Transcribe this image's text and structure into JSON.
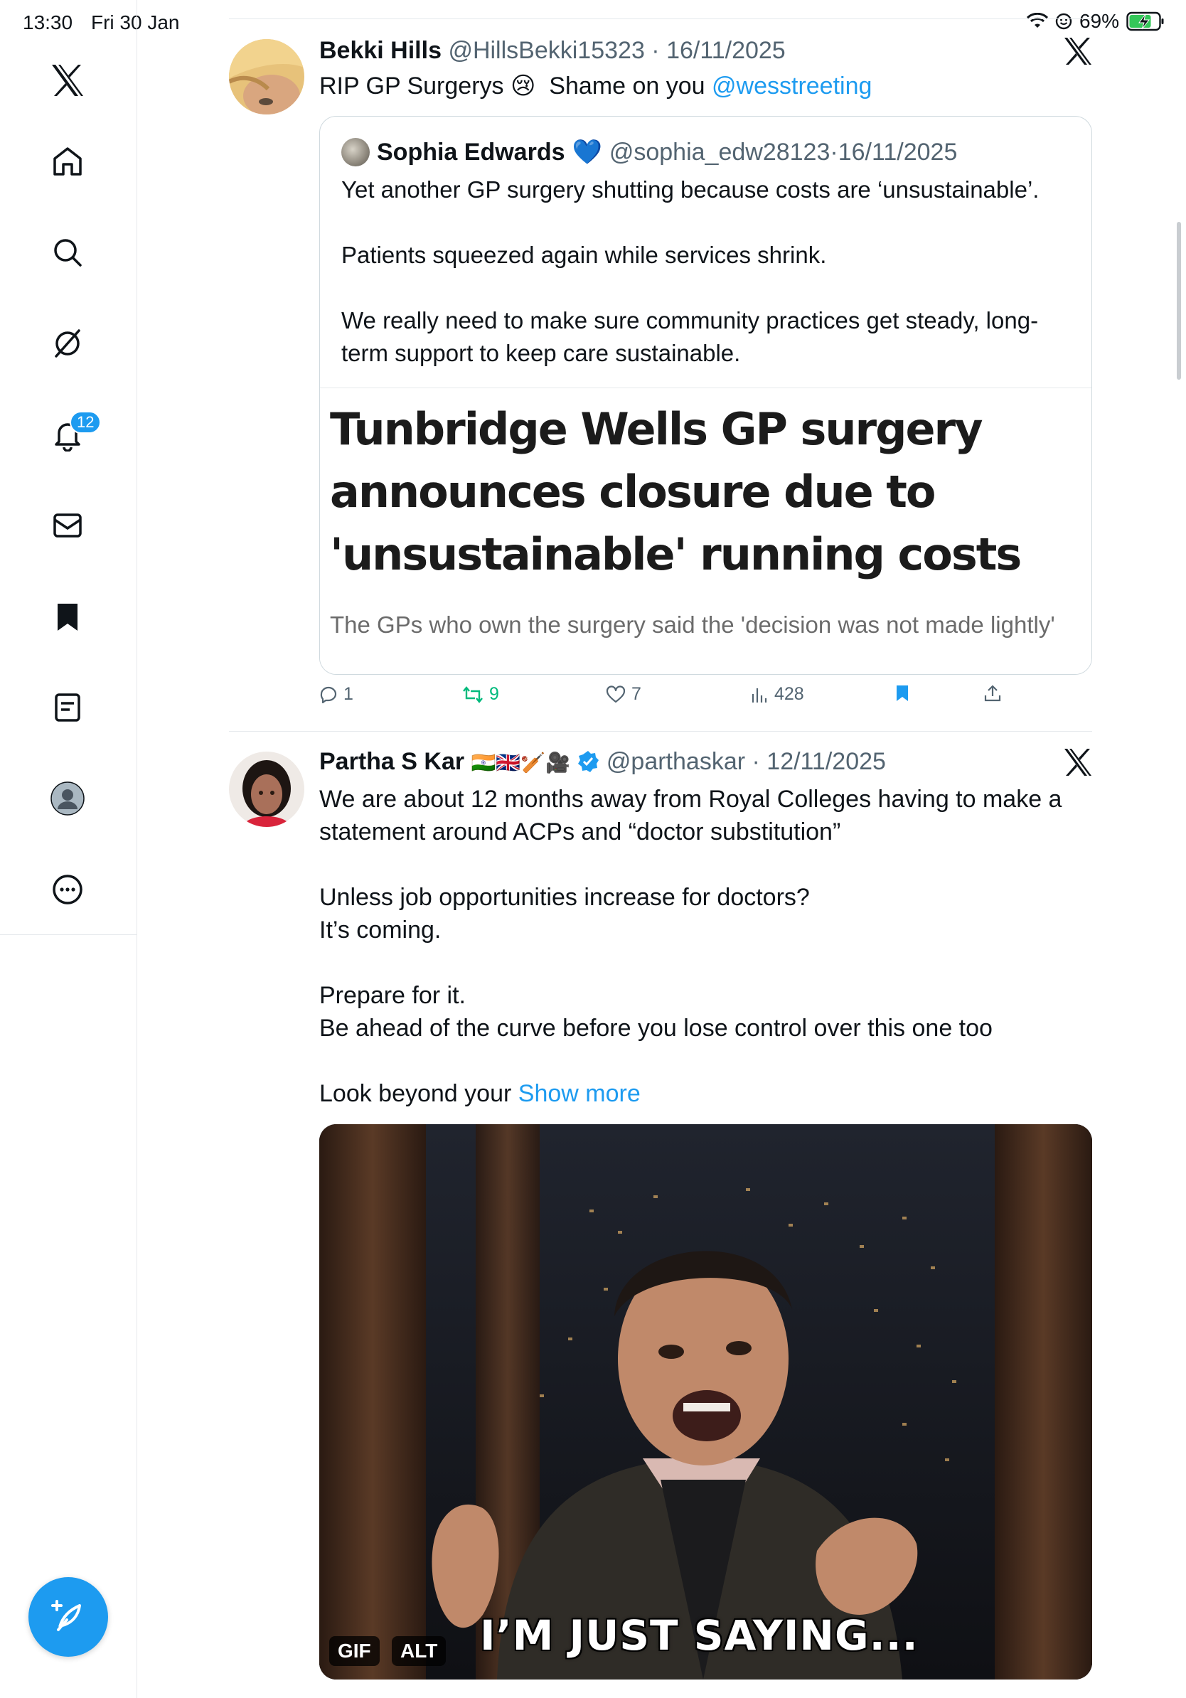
{
  "status_bar": {
    "time": "13:30",
    "date": "Fri 30 Jan",
    "battery": "69%"
  },
  "sidebar": {
    "notification_badge": "12",
    "items": [
      "x-logo",
      "home",
      "search",
      "grok",
      "notifications",
      "messages",
      "bookmarks",
      "lists",
      "profile",
      "more"
    ]
  },
  "tweets": [
    {
      "name": "Bekki Hills",
      "handle": "@HillsBekki15323",
      "date": "16/11/2025",
      "text_before": "RIP GP Surgerys 😢  Shame on you ",
      "mention": "@wesstreeting",
      "quote": {
        "name": "Sophia Edwards",
        "emoji": "💙",
        "handle": "@sophia_edw28123",
        "date": "16/11/2025",
        "text": "Yet another GP surgery shutting because costs are ‘unsustainable’.\n\nPatients squeezed again while services shrink.\n\nWe really need to make sure community practices get steady, long-term support to keep care sustainable.",
        "headline": "Tunbridge Wells GP surgery\nannounces closure due to\n'unsustainable' running costs",
        "subhead": "The GPs who own the surgery said the 'decision was not made lightly'"
      },
      "stats": {
        "replies": "1",
        "reposts": "9",
        "likes": "7",
        "views": "428"
      }
    },
    {
      "name": "Partha S Kar",
      "flags": "🇮🇳🇬🇧🏏🎥",
      "handle": "@parthaskar",
      "date": "12/11/2025",
      "text": "We are about 12 months away from Royal Colleges having to make a\nstatement around ACPs and “doctor substitution”\n\nUnless job opportunities increase for doctors?\nIt’s coming.\n\nPrepare for it.\nBe ahead of the curve before you lose control over this one too\n\nLook beyond your ",
      "show_more": "Show more",
      "media": {
        "caption": "I’M JUST SAYING...",
        "gif_label": "GIF",
        "alt_label": "ALT"
      }
    }
  ],
  "colors": {
    "accent": "#1d9bf0",
    "repost": "#00ba7c",
    "muted": "#536471",
    "border": "#cfd9de"
  }
}
